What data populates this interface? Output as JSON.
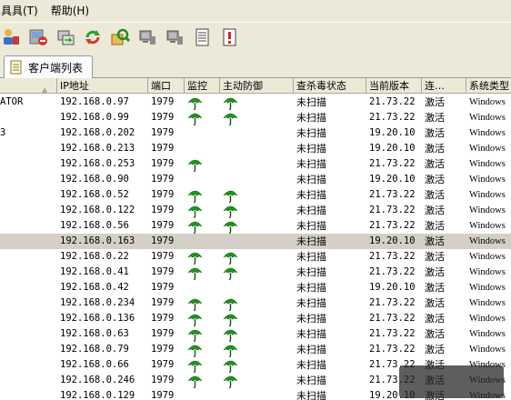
{
  "menu": [
    {
      "label": "具具(T)"
    },
    {
      "label": "帮助(H)"
    }
  ],
  "tab": {
    "label": "客户端列表"
  },
  "columns": [
    "",
    "IP地址",
    "端口",
    "监控",
    "主动防御",
    "查杀毒状态",
    "当前版本",
    "连…",
    "系统类型"
  ],
  "rows": [
    {
      "name": "ATOR",
      "ip": "192.168.0.97",
      "port": "1979",
      "monitor": true,
      "active": true,
      "status": "未扫描",
      "version": "21.73.22",
      "conn": "激活",
      "os": "Windows"
    },
    {
      "name": "",
      "ip": "192.168.0.99",
      "port": "1979",
      "monitor": true,
      "active": true,
      "status": "未扫描",
      "version": "21.73.22",
      "conn": "激活",
      "os": "Windows"
    },
    {
      "name": "3",
      "ip": "192.168.0.202",
      "port": "1979",
      "monitor": false,
      "active": false,
      "status": "未扫描",
      "version": "19.20.10",
      "conn": "激活",
      "os": "Windows"
    },
    {
      "name": "",
      "ip": "192.168.0.213",
      "port": "1979",
      "monitor": false,
      "active": false,
      "status": "未扫描",
      "version": "19.20.10",
      "conn": "激活",
      "os": "Windows"
    },
    {
      "name": "",
      "ip": "192.168.0.253",
      "port": "1979",
      "monitor": true,
      "active": false,
      "status": "未扫描",
      "version": "21.73.22",
      "conn": "激活",
      "os": "Windows"
    },
    {
      "name": "",
      "ip": "192.168.0.90",
      "port": "1979",
      "monitor": false,
      "active": false,
      "status": "未扫描",
      "version": "19.20.10",
      "conn": "激活",
      "os": "Windows"
    },
    {
      "name": "",
      "ip": "192.168.0.52",
      "port": "1979",
      "monitor": true,
      "active": true,
      "status": "未扫描",
      "version": "21.73.22",
      "conn": "激活",
      "os": "Windows"
    },
    {
      "name": "",
      "ip": "192.168.0.122",
      "port": "1979",
      "monitor": true,
      "active": true,
      "status": "未扫描",
      "version": "21.73.22",
      "conn": "激活",
      "os": "Windows"
    },
    {
      "name": "",
      "ip": "192.168.0.56",
      "port": "1979",
      "monitor": true,
      "active": true,
      "status": "未扫描",
      "version": "21.73.22",
      "conn": "激活",
      "os": "Windows"
    },
    {
      "name": "",
      "ip": "192.168.0.163",
      "port": "1979",
      "monitor": false,
      "active": false,
      "status": "未扫描",
      "version": "19.20.10",
      "conn": "激活",
      "os": "Windows",
      "selected": true
    },
    {
      "name": "",
      "ip": "192.168.0.22",
      "port": "1979",
      "monitor": true,
      "active": true,
      "status": "未扫描",
      "version": "21.73.22",
      "conn": "激活",
      "os": "Windows"
    },
    {
      "name": "",
      "ip": "192.168.0.41",
      "port": "1979",
      "monitor": true,
      "active": true,
      "status": "未扫描",
      "version": "21.73.22",
      "conn": "激活",
      "os": "Windows"
    },
    {
      "name": "",
      "ip": "192.168.0.42",
      "port": "1979",
      "monitor": false,
      "active": false,
      "status": "未扫描",
      "version": "19.20.10",
      "conn": "激活",
      "os": "Windows"
    },
    {
      "name": "",
      "ip": "192.168.0.234",
      "port": "1979",
      "monitor": true,
      "active": true,
      "status": "未扫描",
      "version": "21.73.22",
      "conn": "激活",
      "os": "Windows"
    },
    {
      "name": "",
      "ip": "192.168.0.136",
      "port": "1979",
      "monitor": true,
      "active": true,
      "status": "未扫描",
      "version": "21.73.22",
      "conn": "激活",
      "os": "Windows"
    },
    {
      "name": "",
      "ip": "192.168.0.63",
      "port": "1979",
      "monitor": true,
      "active": true,
      "status": "未扫描",
      "version": "21.73.22",
      "conn": "激活",
      "os": "Windows"
    },
    {
      "name": "",
      "ip": "192.168.0.79",
      "port": "1979",
      "monitor": true,
      "active": true,
      "status": "未扫描",
      "version": "21.73.22",
      "conn": "激活",
      "os": "Windows"
    },
    {
      "name": "",
      "ip": "192.168.0.66",
      "port": "1979",
      "monitor": true,
      "active": true,
      "status": "未扫描",
      "version": "21.73.22",
      "conn": "激活",
      "os": "Windows"
    },
    {
      "name": "",
      "ip": "192.168.0.246",
      "port": "1979",
      "monitor": true,
      "active": true,
      "status": "未扫描",
      "version": "21.73.22",
      "conn": "激活",
      "os": "Windows"
    },
    {
      "name": "",
      "ip": "192.168.0.129",
      "port": "1979",
      "monitor": false,
      "active": false,
      "status": "未扫描",
      "version": "19.20.10",
      "conn": "激活",
      "os": "Windows"
    }
  ],
  "toolbar_icons": [
    "user-tool-icon",
    "remove-client-icon",
    "transfer-icon",
    "refresh-icon",
    "scan-icon",
    "network-computer-icon",
    "network-computer-icon",
    "report-icon",
    "alert-icon"
  ],
  "colors": {
    "umbrella": "#1a9a1a",
    "selected_row": "#d4d0c8",
    "chrome": "#ece9d8"
  }
}
